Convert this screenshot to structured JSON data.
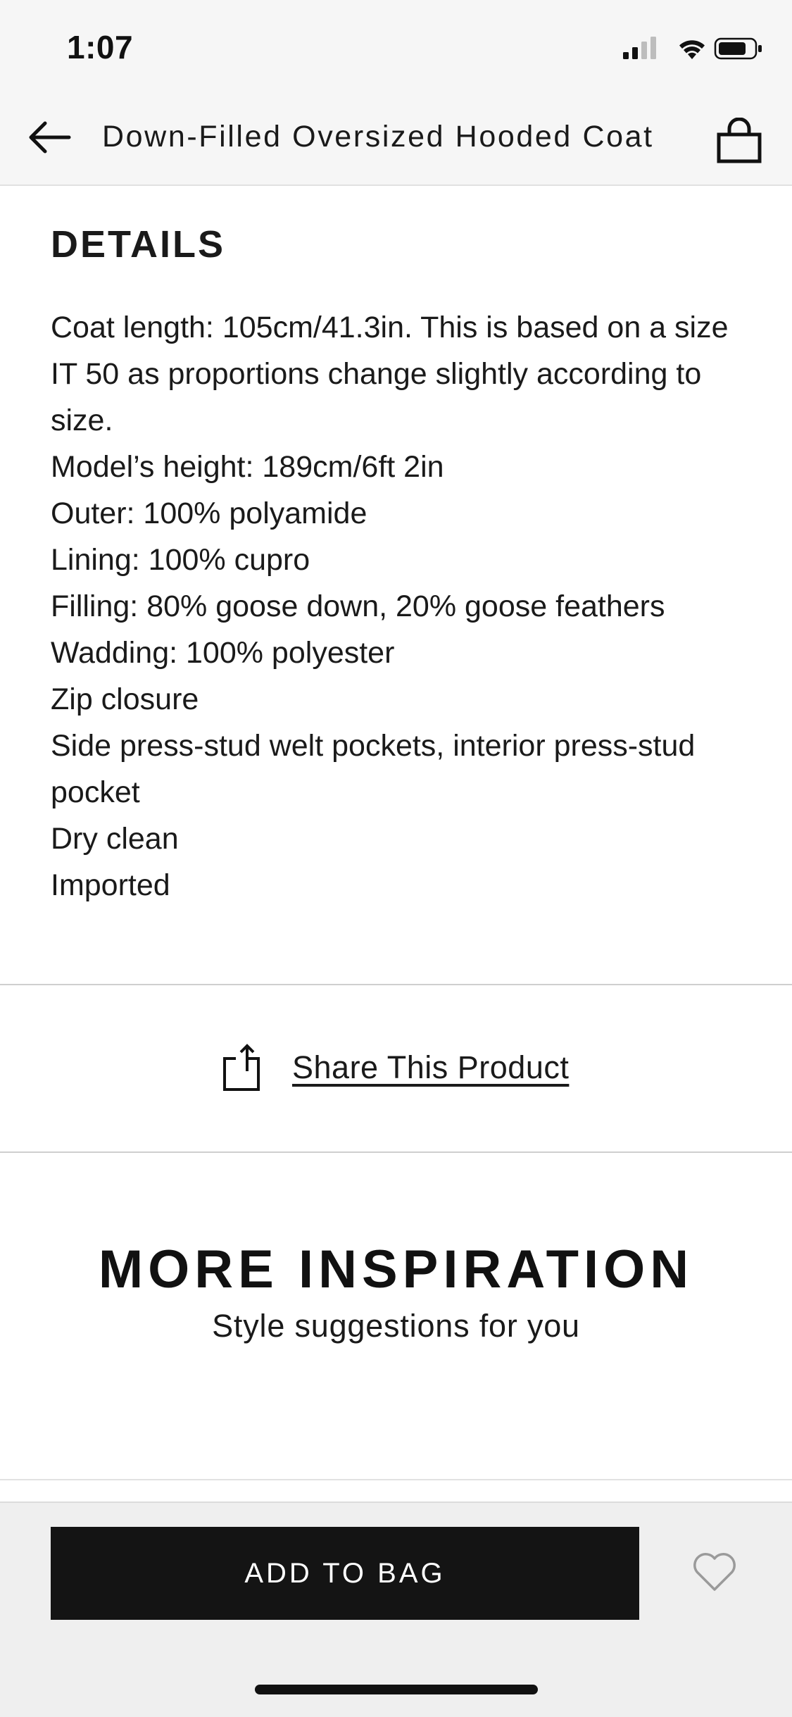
{
  "status_bar": {
    "time": "1:07"
  },
  "header": {
    "title": "Down-Filled Oversized Hooded Coat",
    "back_icon": "arrow-left-icon",
    "bag_icon": "shopping-bag-icon"
  },
  "details": {
    "heading": "DETAILS",
    "lines": [
      "Coat length: 105cm/41.3in. This is based on a size IT 50 as proportions change slightly according to size.",
      "Model’s height: 189cm/6ft 2in",
      "Outer: 100% polyamide",
      "Lining: 100% cupro",
      "Filling: 80% goose down, 20% goose feathers",
      "Wadding: 100% polyester",
      "Zip closure",
      "Side press-stud welt pockets, interior press-stud pocket",
      "Dry clean",
      "Imported"
    ]
  },
  "share": {
    "label": "Share This Product",
    "icon": "share-icon"
  },
  "inspiration": {
    "title": "MORE INSPIRATION",
    "subtitle": "Style suggestions for you"
  },
  "actions": {
    "add_to_bag_label": "ADD TO BAG",
    "wishlist_icon": "heart-icon"
  },
  "colors": {
    "button_bg": "#141414",
    "bar_bg": "#f6f6f6",
    "action_bar_bg": "#efefef",
    "divider": "#cfcfcf"
  }
}
